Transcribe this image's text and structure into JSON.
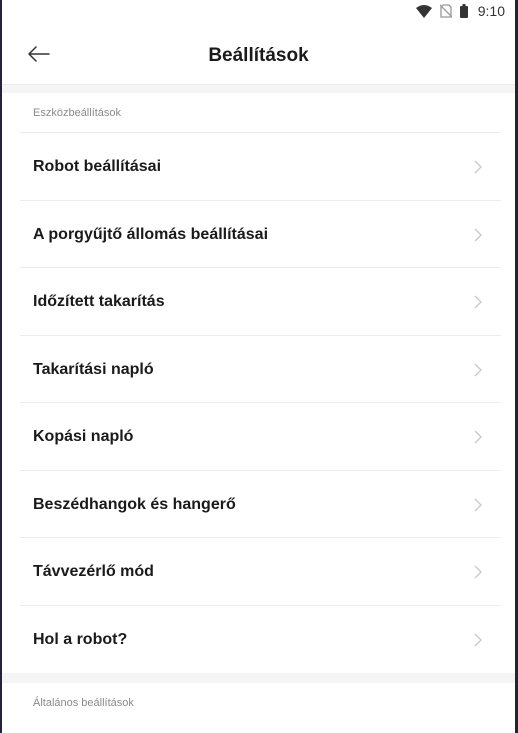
{
  "status_bar": {
    "time": "9:10",
    "icons": [
      "wifi-icon",
      "no-sim-icon",
      "battery-icon"
    ]
  },
  "header": {
    "title": "Beállítások",
    "back_icon": "arrow-left-icon"
  },
  "sections": {
    "device_settings": {
      "label": "Eszközbeállítások",
      "items": [
        {
          "label": "Robot beállításai"
        },
        {
          "label": "A porgyűjtő állomás beállításai"
        },
        {
          "label": "Időzített takarítás"
        },
        {
          "label": "Takarítási napló"
        },
        {
          "label": "Kopási napló"
        },
        {
          "label": "Beszédhangok és hangerő"
        },
        {
          "label": "Távvezérlő mód"
        },
        {
          "label": "Hol a robot?"
        }
      ]
    },
    "general_settings": {
      "label": "Általános beállítások"
    }
  },
  "colors": {
    "background": "#ffffff",
    "text_primary": "#1a1a1a",
    "text_secondary": "#8a8a8a",
    "divider": "#ececec",
    "chevron": "#c8c8c8"
  }
}
